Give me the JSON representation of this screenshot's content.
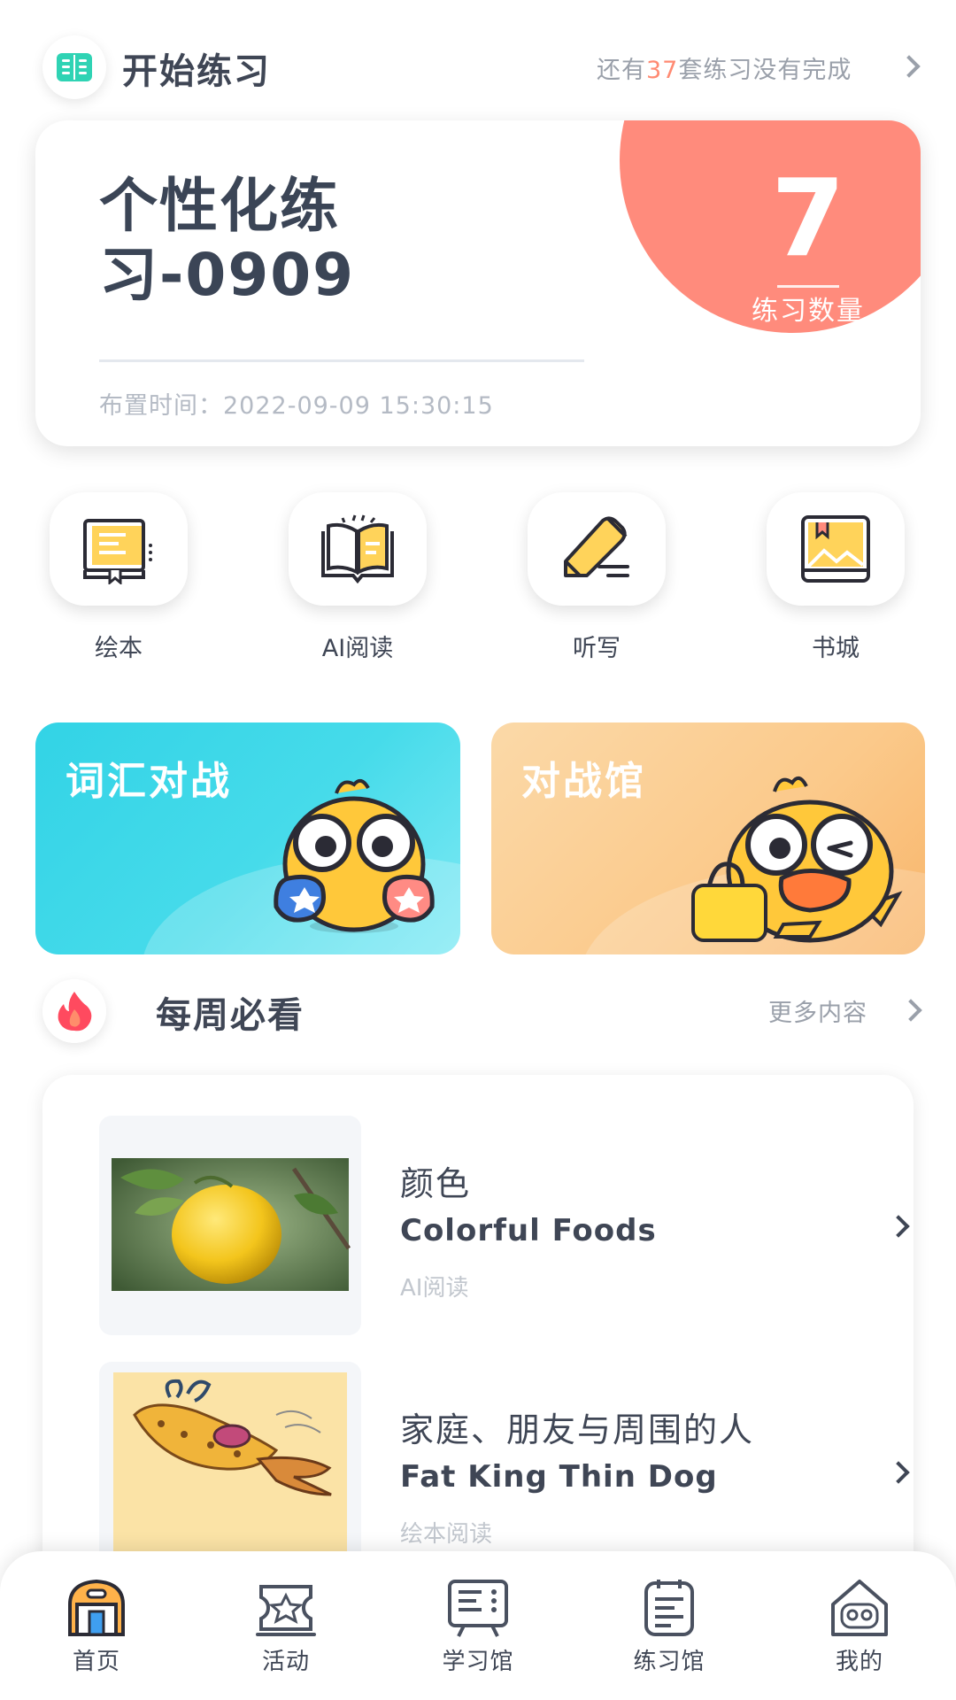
{
  "practice_header": {
    "title": "开始练习",
    "pending_prefix": "还有",
    "pending_count": "37",
    "pending_suffix": "套练习没有完成"
  },
  "practice_card": {
    "name": "个性化练习-0909",
    "assigned_label": "布置时间：",
    "assigned_time": "2022-09-09 15:30:15",
    "count": "7",
    "count_label": "练习数量"
  },
  "quick_entries": [
    {
      "label": "绘本",
      "icon": "picture-book-icon"
    },
    {
      "label": "AI阅读",
      "icon": "open-book-icon"
    },
    {
      "label": "听写",
      "icon": "pencil-icon"
    },
    {
      "label": "书城",
      "icon": "bookstore-icon"
    }
  ],
  "battles": {
    "vocab": {
      "title": "词汇对战"
    },
    "hall": {
      "title": "对战馆"
    }
  },
  "weekly": {
    "title": "每周必看",
    "more_label": "更多内容",
    "items": [
      {
        "cn_title": "颜色",
        "en_title": "Colorful Foods",
        "category": "AI阅读"
      },
      {
        "cn_title": "家庭、朋友与周围的人",
        "en_title": "Fat King Thin Dog",
        "category": "绘本阅读"
      }
    ]
  },
  "nav": [
    {
      "label": "首页",
      "icon": "home-icon",
      "active": true
    },
    {
      "label": "活动",
      "icon": "activity-icon",
      "active": false
    },
    {
      "label": "学习馆",
      "icon": "study-hall-icon",
      "active": false
    },
    {
      "label": "练习馆",
      "icon": "practice-hall-icon",
      "active": false
    },
    {
      "label": "我的",
      "icon": "profile-icon",
      "active": false
    }
  ],
  "colors": {
    "accent_coral": "#ff8b7c",
    "accent_teal": "#32d3e6",
    "accent_orange": "#f8b56a",
    "text_dark": "#3f4655",
    "text_muted": "#9aa0aa"
  }
}
